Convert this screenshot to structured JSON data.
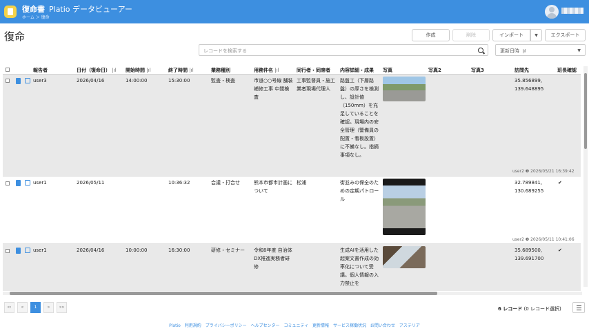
{
  "header": {
    "app_name": "復命書",
    "app_sub": "Platio データビューアー",
    "breadcrumb": "ホーム ＞ 復命"
  },
  "page": {
    "title": "復命"
  },
  "toolbar": {
    "create": "作成",
    "delete": "削除",
    "import": "インポート",
    "export": "エクスポート"
  },
  "search": {
    "placeholder": "レコードを検索する"
  },
  "sort": {
    "label": "更新日時"
  },
  "columns": [
    "報告者",
    "日付（復命日）",
    "開始時間",
    "終了時間",
    "業務種別",
    "用務件名",
    "同行者・同席者",
    "内容詳細・成果",
    "写真",
    "写真2",
    "写真3",
    "訪問先",
    "班長確認"
  ],
  "rows": [
    {
      "reporter": "user3",
      "date": "2026/04/16",
      "start": "14:00:00",
      "end": "15:30:00",
      "type": "監査・検査",
      "subject": "市道○○号線 舗装補修工事 中間検査",
      "companion": "工事監督員・施工業者現場代理人",
      "detail": "路盤工（下層路盤）の厚さを検測し、設計値（150mm）を充足していることを確認。現場内の安全管理（警備員の配置・看板設置）に不備なし。指摘事項なし。",
      "location": "35.856899, 139.648895",
      "confirm": "",
      "updated": "user2 ❶ 2026/05/21 16:39:42"
    },
    {
      "reporter": "user1",
      "date": "2026/05/11",
      "start": "",
      "end": "10:36:32",
      "type": "会議・打合せ",
      "subject": "熊本市都市計画について",
      "companion": "松浦",
      "detail": "街並みの保全のための定期パトロール",
      "location": "32.789841, 130.689255",
      "confirm": "✔",
      "updated": "user2 ❶ 2026/05/11 10:41:06"
    },
    {
      "reporter": "user1",
      "date": "2026/04/16",
      "start": "10:00:00",
      "end": "16:30:00",
      "type": "研修・セミナー",
      "subject": "令和8年度 自治体DX推進実務者研修",
      "companion": "",
      "detail": "生成AIを活用した起案文書作成の効率化について受講。個人情報の入力禁止を",
      "location": "35.689500, 139.691700",
      "confirm": "✔",
      "updated": ""
    }
  ],
  "pager": {
    "first": "«‹",
    "prev": "«",
    "current": "1",
    "next": "»",
    "last": "»»"
  },
  "footer_count": {
    "num": "6 レコード",
    "sel": "(0 レコード選択)"
  },
  "links": [
    "Platio",
    "利用規約",
    "プライバシーポリシー",
    "ヘルプセンター",
    "コミュニティ",
    "更新情報",
    "サービス稼働状況",
    "お問い合わせ",
    "アステリア"
  ]
}
